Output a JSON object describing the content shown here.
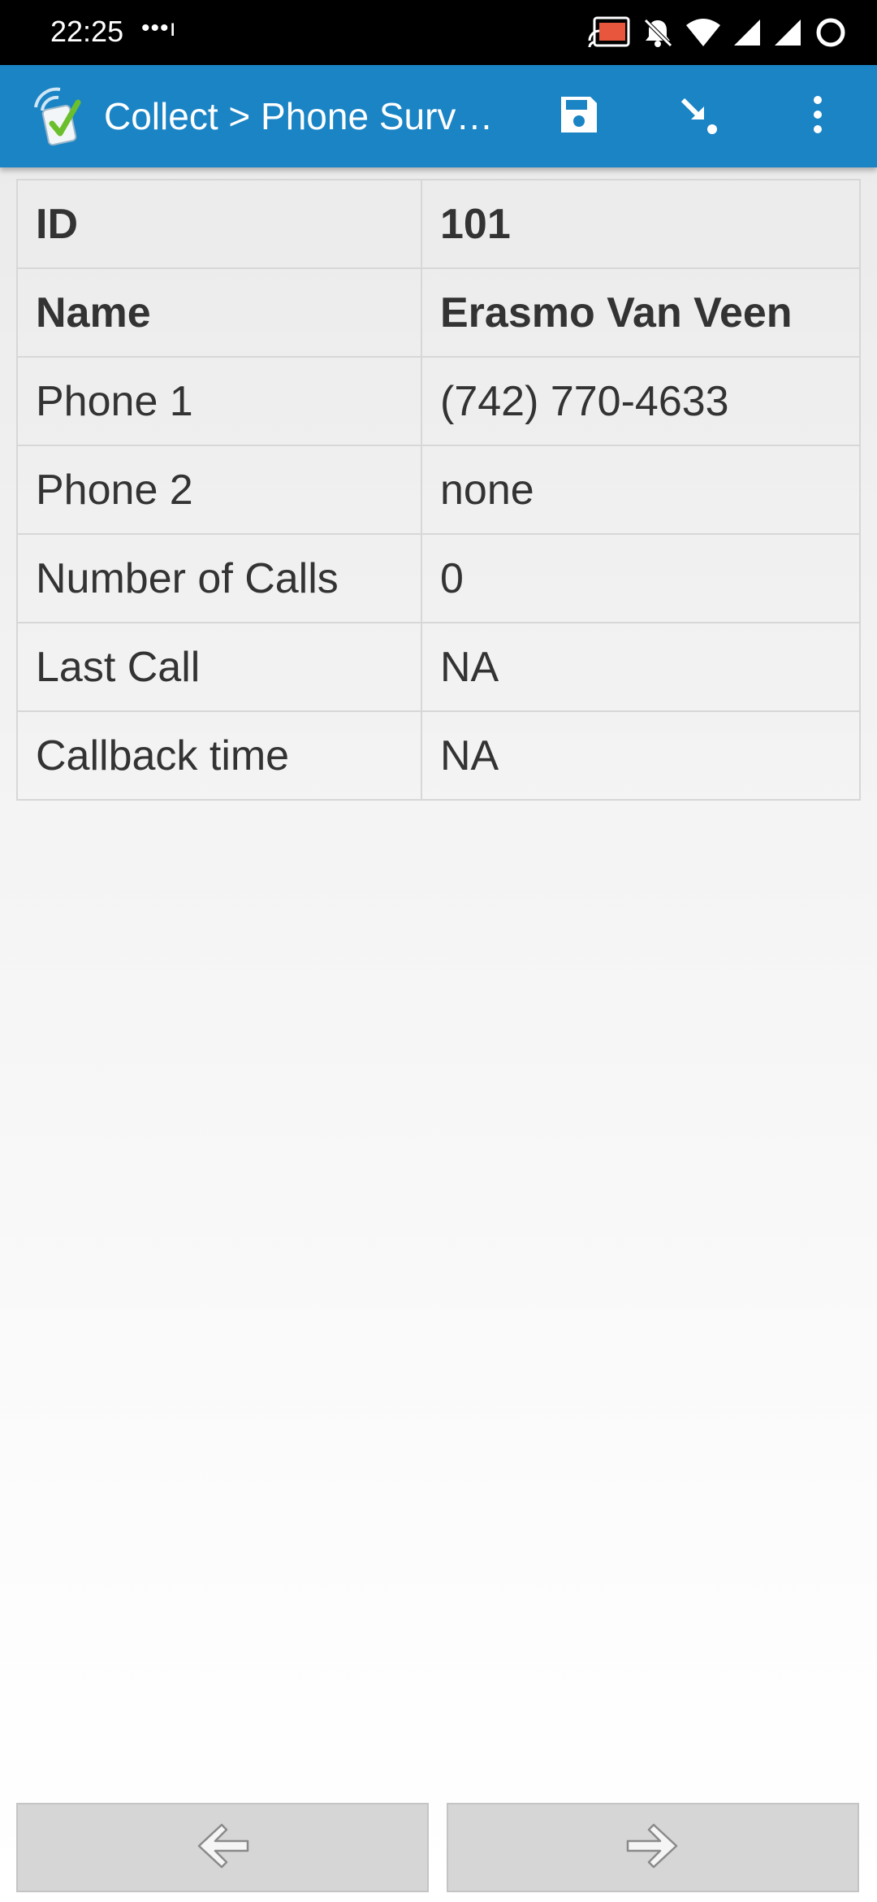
{
  "status_bar": {
    "time": "22:25",
    "notification_dots": "•••ı",
    "icons": [
      "cast-icon",
      "bell-off-icon",
      "wifi-icon",
      "cell-signal-icon",
      "cell-signal-icon-2",
      "battery-ring-icon"
    ]
  },
  "app_bar": {
    "title": "Collect > Phone Surve…",
    "logo_icon": "odk-collect-logo-icon",
    "actions": [
      {
        "name": "save",
        "icon": "save-icon"
      },
      {
        "name": "jump",
        "icon": "jump-to-icon"
      },
      {
        "name": "more",
        "icon": "overflow-menu-icon"
      }
    ],
    "color": "#1a84c5"
  },
  "table": {
    "rows": [
      {
        "key": "ID",
        "value": "101"
      },
      {
        "key": "Name",
        "value": "Erasmo Van Veen"
      },
      {
        "key": "Phone 1",
        "value": "(742) 770-4633"
      },
      {
        "key": "Phone 2",
        "value": "none"
      },
      {
        "key": "Number of Calls",
        "value": "0"
      },
      {
        "key": "Last Call",
        "value": "NA"
      },
      {
        "key": "Callback time",
        "value": "NA"
      }
    ]
  },
  "navigation": {
    "back_icon": "arrow-left-icon",
    "next_icon": "arrow-right-icon"
  }
}
